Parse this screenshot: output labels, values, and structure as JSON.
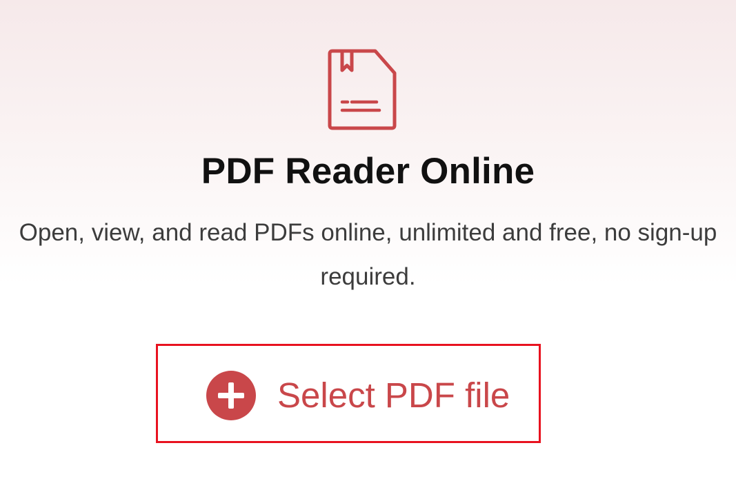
{
  "hero": {
    "icon": "pdf-document-icon",
    "title": "PDF Reader Online",
    "subtitle": "Open, view, and read PDFs online, unlimited and free, no sign-up required."
  },
  "upload": {
    "icon": "plus-circle-icon",
    "button_label": "Select PDF file",
    "highlighted": true
  },
  "colors": {
    "accent": "#c9474a",
    "highlight_border": "#e8121f",
    "title": "#111111",
    "subtitle": "#3c3c3c"
  }
}
